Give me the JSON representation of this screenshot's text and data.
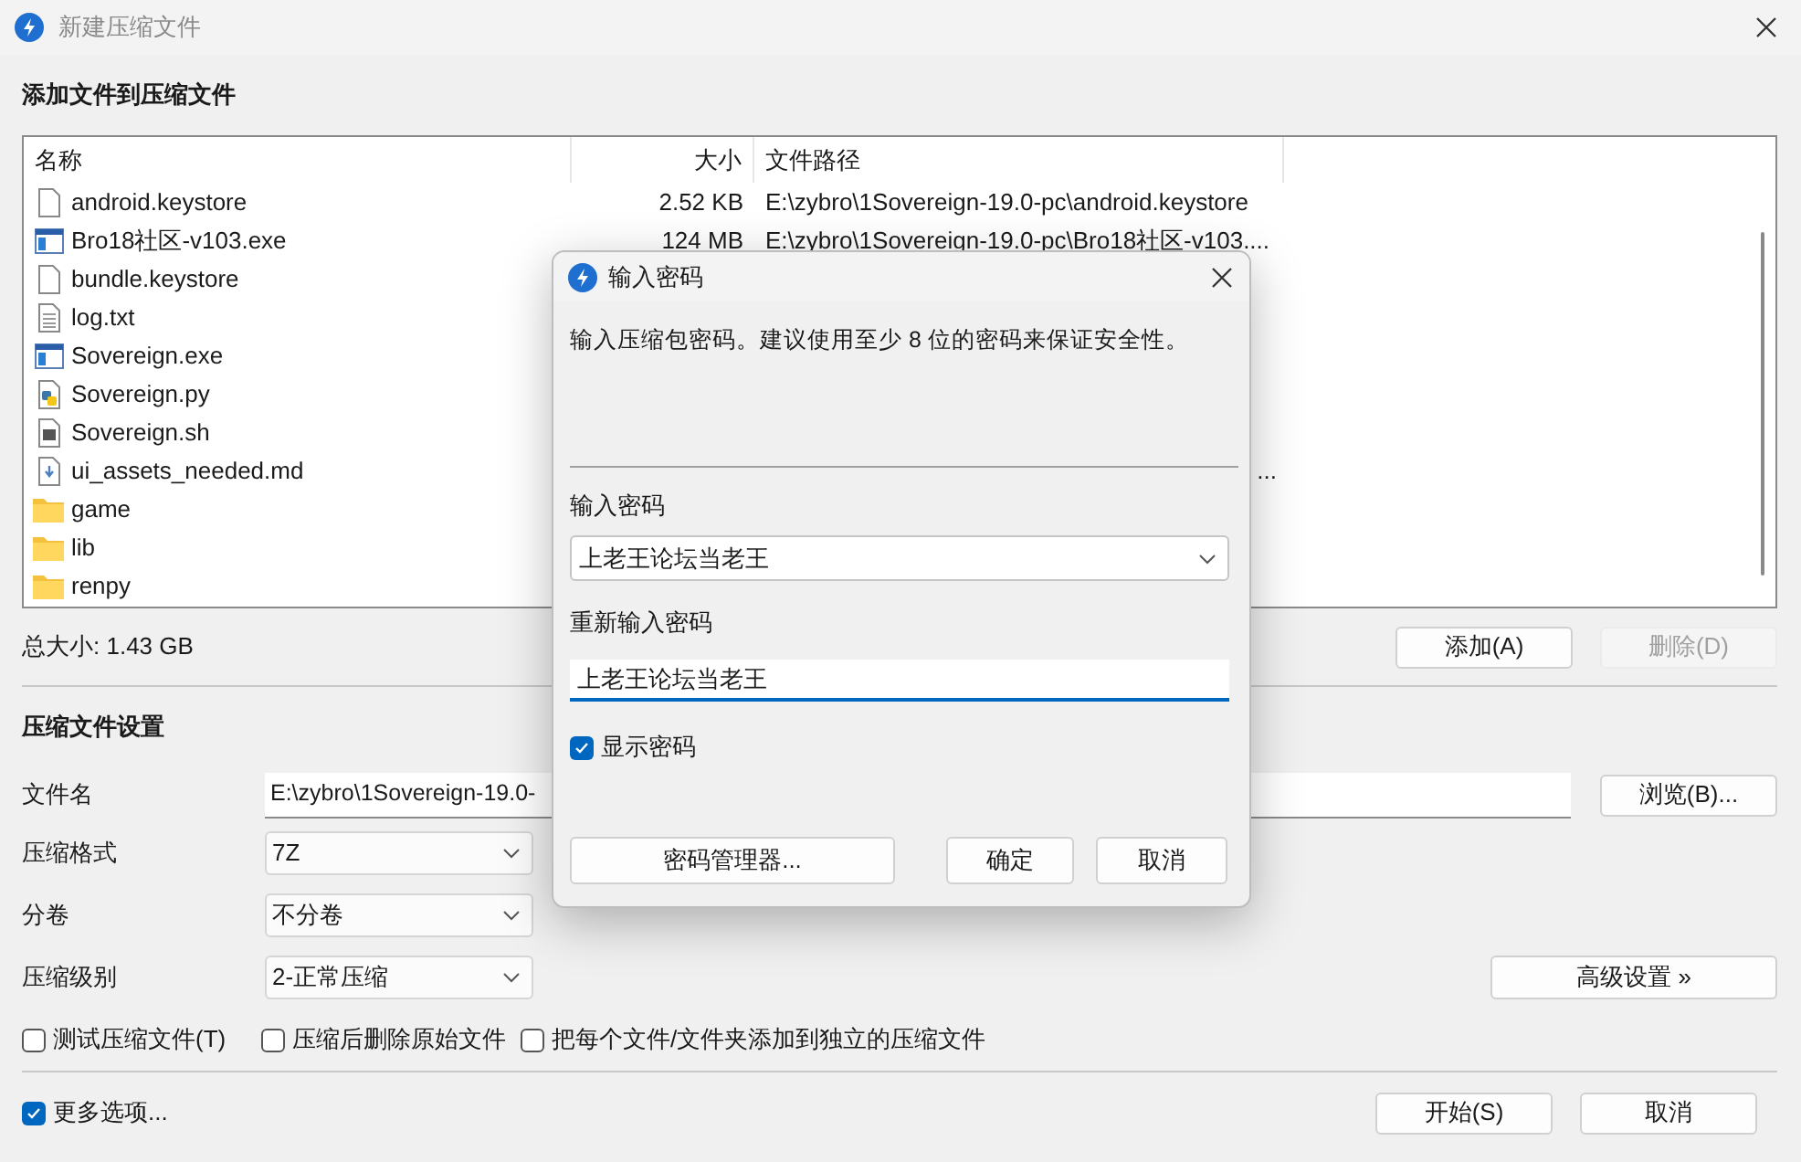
{
  "window": {
    "title": "新建压缩文件"
  },
  "add_section": {
    "heading": "添加文件到压缩文件"
  },
  "file_list": {
    "columns": [
      "名称",
      "大小",
      "文件路径"
    ],
    "rows": [
      {
        "kind": "file",
        "name": "android.keystore",
        "size": "2.52 KB",
        "path": "E:\\zybro\\1Sovereign-19.0-pc\\android.keystore"
      },
      {
        "kind": "exe",
        "name": "Bro18社区-v103.exe",
        "size": "124 MB",
        "path": "E:\\zybro\\1Sovereign-19.0-pc\\Bro18社区-v103...."
      },
      {
        "kind": "file",
        "name": "bundle.keystore"
      },
      {
        "kind": "text",
        "name": "log.txt"
      },
      {
        "kind": "exe",
        "name": "Sovereign.exe"
      },
      {
        "kind": "python",
        "name": "Sovereign.py"
      },
      {
        "kind": "script",
        "name": "Sovereign.sh"
      },
      {
        "kind": "markdown",
        "name": "ui_assets_needed.md",
        "path": "..."
      },
      {
        "kind": "folder",
        "name": "game"
      },
      {
        "kind": "folder",
        "name": "lib"
      },
      {
        "kind": "folder",
        "name": "renpy"
      }
    ]
  },
  "total_size": "总大小: 1.43 GB",
  "list_buttons": [
    {
      "label": "添加(A)",
      "disabled": false
    },
    {
      "label": "删除(D)",
      "disabled": true
    }
  ],
  "settings": {
    "heading": "压缩文件设置",
    "filename": {
      "label": "文件名",
      "value": "E:\\zybro\\1Sovereign-19.0-",
      "browse": "浏览(B)..."
    },
    "format": {
      "label": "压缩格式",
      "value": "7Z"
    },
    "volume": {
      "label": "分卷",
      "value": "不分卷"
    },
    "level": {
      "label": "压缩级别",
      "value": "2-正常压缩"
    },
    "advanced": "高级设置 »",
    "options": [
      {
        "label": "测试压缩文件(T)",
        "checked": false
      },
      {
        "label": "压缩后删除原始文件",
        "checked": false
      },
      {
        "label": "把每个文件/文件夹添加到独立的压缩文件",
        "checked": false
      }
    ]
  },
  "more_options": {
    "label": "更多选项...",
    "checked": true
  },
  "footer_buttons": [
    "开始(S)",
    "取消"
  ],
  "dialog": {
    "title": "输入密码",
    "message": "输入压缩包密码。建议使用至少 8 位的密码来保证安全性。",
    "password_label": "输入密码",
    "password": "上老王论坛当老王",
    "confirm_label": "重新输入密码",
    "confirm": "上老王论坛当老王",
    "show_password": {
      "label": "显示密码",
      "checked": true
    },
    "manager_button": "密码管理器...",
    "buttons": [
      "确定",
      "取消"
    ]
  }
}
